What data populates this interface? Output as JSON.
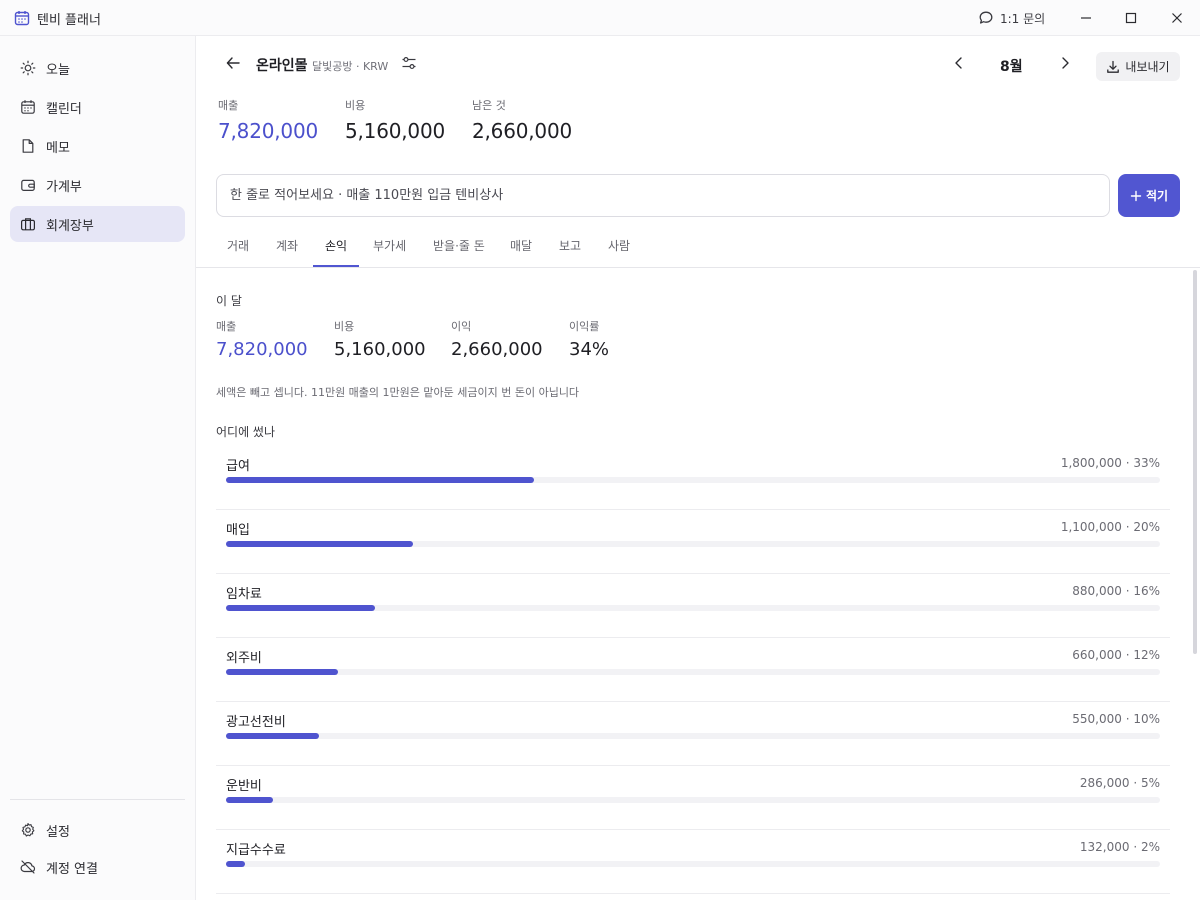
{
  "window": {
    "app_title": "텐비 플래너",
    "inquiry_label": "1:1 문의"
  },
  "sidebar": {
    "items": [
      {
        "label": "오늘",
        "icon": "sun-icon"
      },
      {
        "label": "캘린더",
        "icon": "calendar-icon"
      },
      {
        "label": "메모",
        "icon": "document-icon"
      },
      {
        "label": "가계부",
        "icon": "wallet-icon"
      },
      {
        "label": "회계장부",
        "icon": "briefcase-icon",
        "active": true
      }
    ],
    "bottom_items": [
      {
        "label": "설정",
        "icon": "gear-icon"
      },
      {
        "label": "계정 연결",
        "icon": "cloud-off-icon"
      }
    ]
  },
  "header": {
    "ledger_name": "온라인몰",
    "ledger_meta": "달빛공방 · KRW",
    "month": "8월",
    "export_label": "내보내기"
  },
  "summary": {
    "sales_label": "매출",
    "sales_value": "7,820,000",
    "cost_label": "비용",
    "cost_value": "5,160,000",
    "remaining_label": "남은 것",
    "remaining_value": "2,660,000"
  },
  "entry": {
    "placeholder": "한 줄로 적어보세요 · 매출 110만원 입금 텐비상사",
    "write_label": "적기"
  },
  "tabs": [
    "거래",
    "계좌",
    "손익",
    "부가세",
    "받을·줄 돈",
    "매달",
    "보고",
    "사람"
  ],
  "active_tab": "손익",
  "this_month": {
    "title": "이 달",
    "sales_label": "매출",
    "sales_value": "7,820,000",
    "cost_label": "비용",
    "cost_value": "5,160,000",
    "profit_label": "이익",
    "profit_value": "2,660,000",
    "margin_label": "이익률",
    "margin_value": "34%",
    "note": "세액은 빼고 셉니다. 11만원 매출의 1만원은 맡아둔 세금이지 번 돈이 아닙니다"
  },
  "spending": {
    "title": "어디에 썼나",
    "categories": [
      {
        "name": "급여",
        "amount": "1,800,000 · 33%",
        "share": 0.33
      },
      {
        "name": "매입",
        "amount": "1,100,000 · 20%",
        "share": 0.2
      },
      {
        "name": "임차료",
        "amount": "880,000 · 16%",
        "share": 0.16
      },
      {
        "name": "외주비",
        "amount": "660,000 · 12%",
        "share": 0.12
      },
      {
        "name": "광고선전비",
        "amount": "550,000 · 10%",
        "share": 0.1
      },
      {
        "name": "운반비",
        "amount": "286,000 · 5%",
        "share": 0.05
      },
      {
        "name": "지급수수료",
        "amount": "132,000 · 2%",
        "share": 0.02
      }
    ]
  },
  "colors": {
    "accent": "#5156d1",
    "accent_text": "#4b50cc",
    "active_nav_bg": "#e6e6f6"
  }
}
